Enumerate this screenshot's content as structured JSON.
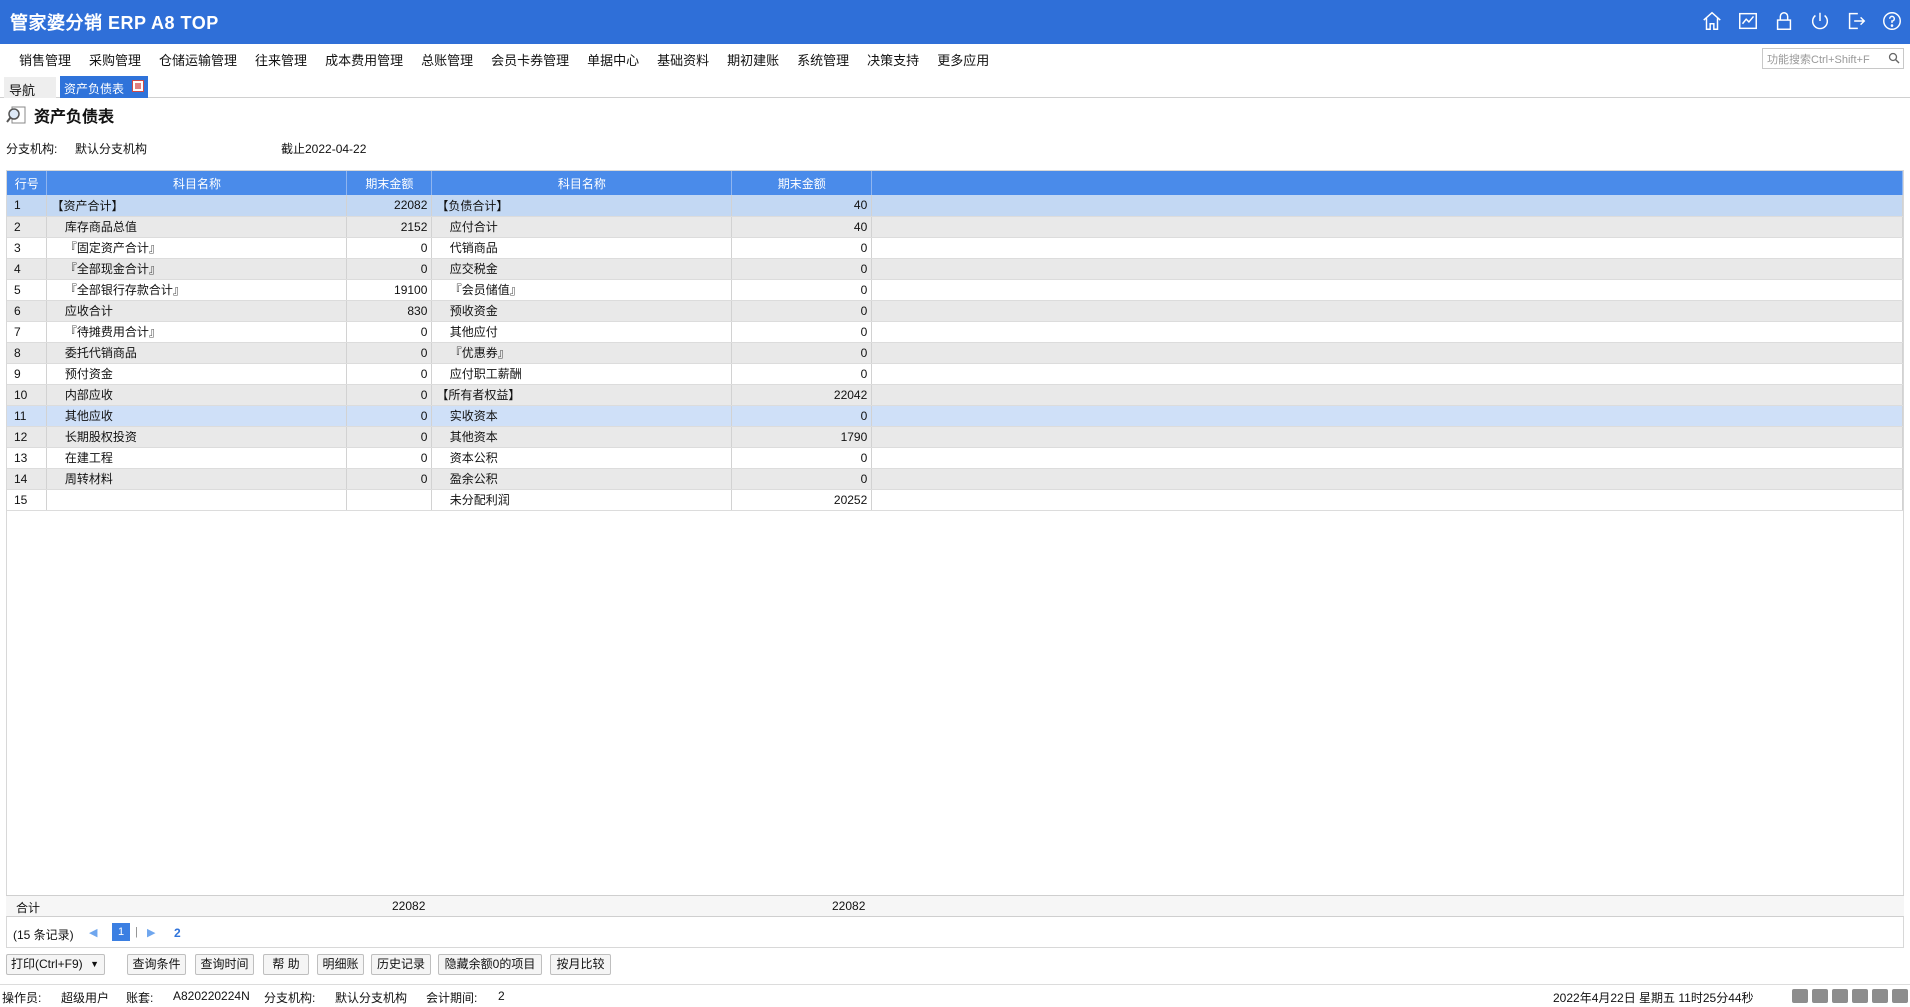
{
  "app": {
    "title": "管家婆分销 ERP A8 TOP"
  },
  "menu": {
    "items": [
      "销售管理",
      "采购管理",
      "仓储运输管理",
      "往来管理",
      "成本费用管理",
      "总账管理",
      "会员卡券管理",
      "单据中心",
      "基础资料",
      "期初建账",
      "系统管理",
      "决策支持",
      "更多应用"
    ],
    "search_placeholder": "功能搜索Ctrl+Shift+F"
  },
  "tabs": {
    "nav_label": "导航",
    "active_label": "资产负债表"
  },
  "report": {
    "title": "资产负债表",
    "branch_label": "分支机构:",
    "branch_value": "默认分支机构",
    "date_text": "截止2022-04-22"
  },
  "table": {
    "headers": [
      "行号",
      "科目名称",
      "期末金额",
      "科目名称",
      "期末金额"
    ],
    "rows": [
      {
        "no": "1",
        "asset": "【资产合计】",
        "asset_amt": "22082",
        "liab": "【负债合计】",
        "liab_amt": "40"
      },
      {
        "no": "2",
        "asset": "    库存商品总值",
        "asset_amt": "2152",
        "liab": "    应付合计",
        "liab_amt": "40"
      },
      {
        "no": "3",
        "asset": "    『固定资产合计』",
        "asset_amt": "0",
        "liab": "    代销商品",
        "liab_amt": "0"
      },
      {
        "no": "4",
        "asset": "    『全部现金合计』",
        "asset_amt": "0",
        "liab": "    应交税金",
        "liab_amt": "0"
      },
      {
        "no": "5",
        "asset": "    『全部银行存款合计』",
        "asset_amt": "19100",
        "liab": "    『会员储值』",
        "liab_amt": "0"
      },
      {
        "no": "6",
        "asset": "    应收合计",
        "asset_amt": "830",
        "liab": "    预收资金",
        "liab_amt": "0"
      },
      {
        "no": "7",
        "asset": "    『待摊费用合计』",
        "asset_amt": "0",
        "liab": "    其他应付",
        "liab_amt": "0"
      },
      {
        "no": "8",
        "asset": "    委托代销商品",
        "asset_amt": "0",
        "liab": "    『优惠券』",
        "liab_amt": "0"
      },
      {
        "no": "9",
        "asset": "    预付资金",
        "asset_amt": "0",
        "liab": "    应付职工薪酬",
        "liab_amt": "0"
      },
      {
        "no": "10",
        "asset": "    内部应收",
        "asset_amt": "0",
        "liab": "【所有者权益】",
        "liab_amt": "22042"
      },
      {
        "no": "11",
        "asset": "    其他应收",
        "asset_amt": "0",
        "liab": "    实收资本",
        "liab_amt": "0"
      },
      {
        "no": "12",
        "asset": "    长期股权投资",
        "asset_amt": "0",
        "liab": "    其他资本",
        "liab_amt": "1790"
      },
      {
        "no": "13",
        "asset": "    在建工程",
        "asset_amt": "0",
        "liab": "    资本公积",
        "liab_amt": "0"
      },
      {
        "no": "14",
        "asset": "    周转材料",
        "asset_amt": "0",
        "liab": "    盈余公积",
        "liab_amt": "0"
      },
      {
        "no": "15",
        "asset": "",
        "asset_amt": "",
        "liab": "    未分配利润",
        "liab_amt": "20252"
      }
    ],
    "total_label": "合计",
    "total_asset": "22082",
    "total_liab": "22082"
  },
  "pager": {
    "records": "(15 条记录)",
    "current_page": "1",
    "total_pages": "2"
  },
  "toolbar": {
    "print": "打印(Ctrl+F9)",
    "query_cond": "查询条件",
    "query_time": "查询时间",
    "help": "帮 助",
    "detail": "明细账",
    "history": "历史记录",
    "hide_zero": "隐藏余额0的项目",
    "monthly": "按月比较"
  },
  "status": {
    "operator_label": "操作员:",
    "operator": "超级用户",
    "account_label": "账套:",
    "account": "A820220224N",
    "branch_label": "分支机构:",
    "branch": "默认分支机构",
    "period_label": "会计期间:",
    "period": "2",
    "datetime": "2022年4月22日  星期五  11时25分44秒"
  }
}
